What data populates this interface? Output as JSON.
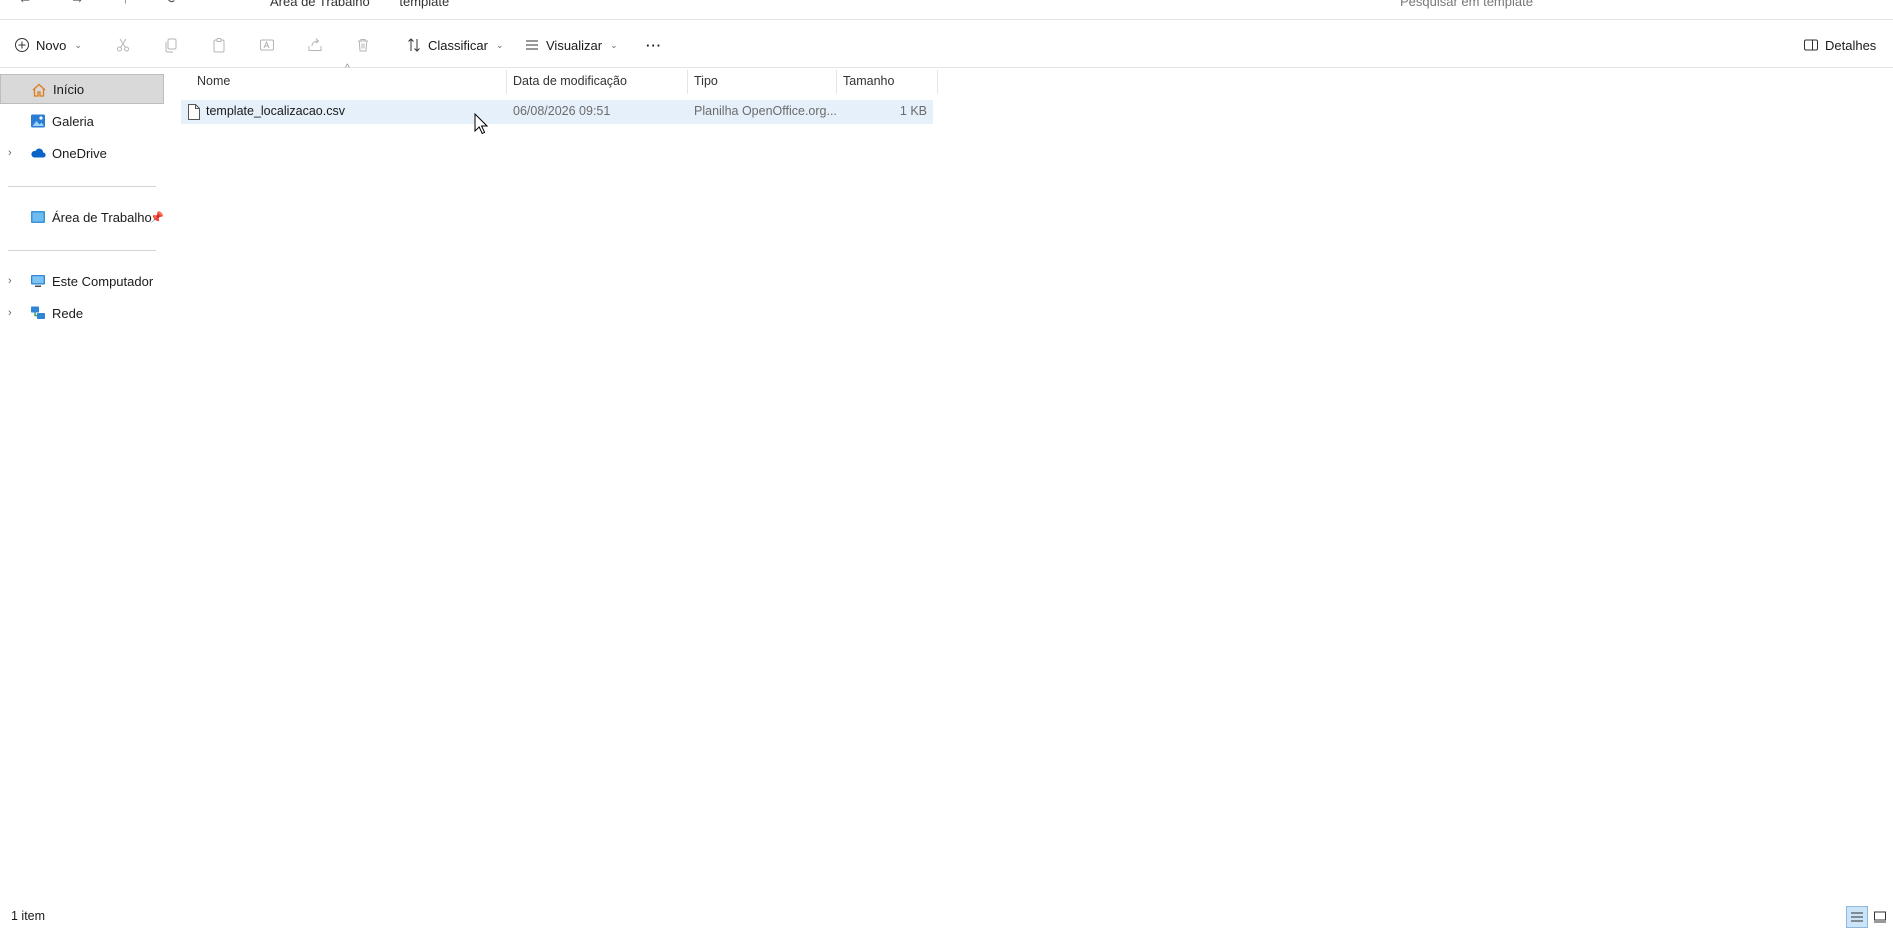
{
  "address_bar": {
    "breadcrumbs": [
      "Área de Trabalho",
      "template"
    ],
    "search_placeholder": "Pesquisar em template"
  },
  "toolbar": {
    "new_label": "Novo",
    "sort_label": "Classificar",
    "view_label": "Visualizar",
    "more_label": "···",
    "details_label": "Detalhes"
  },
  "sidebar": {
    "items": [
      {
        "label": "Início",
        "icon": "home-icon",
        "selected": true
      },
      {
        "label": "Galeria",
        "icon": "gallery-icon"
      },
      {
        "label": "OneDrive",
        "icon": "onedrive-icon",
        "expandable": true
      },
      {
        "label": "Área de Trabalho",
        "icon": "desktop-icon",
        "pinned": true
      },
      {
        "label": "Este Computador",
        "icon": "computer-icon",
        "expandable": true
      },
      {
        "label": "Rede",
        "icon": "network-icon",
        "expandable": true
      }
    ]
  },
  "file_list": {
    "columns": [
      "Nome",
      "Data de modificação",
      "Tipo",
      "Tamanho"
    ],
    "rows": [
      {
        "name": "template_localizacao.csv",
        "modified": "06/08/2026 09:51",
        "type": "Planilha OpenOffice.org...",
        "size": "1 KB"
      }
    ]
  },
  "status_bar": {
    "item_count": "1 item"
  },
  "colors": {
    "selection_row": "#e6f0fb",
    "sidebar_selected": "#d9d9d9",
    "accent": "#0067c0"
  }
}
